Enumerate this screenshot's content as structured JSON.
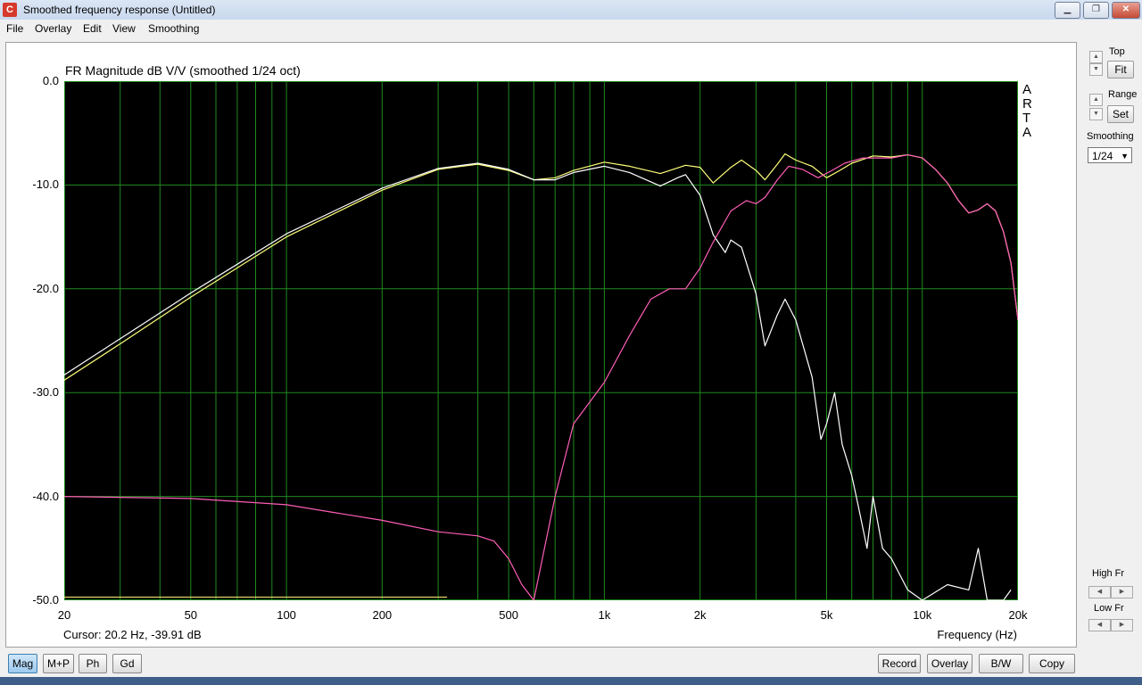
{
  "window": {
    "title": "Smoothed frequency response (Untitled)",
    "app_icon": "arta-app-icon"
  },
  "window_controls": {
    "minimize": "▁",
    "restore": "❐",
    "close": "✕"
  },
  "menu": {
    "file": "File",
    "overlay": "Overlay",
    "edit": "Edit",
    "view": "View",
    "smoothing": "Smoothing"
  },
  "plot": {
    "title": "FR Magnitude dB V/V (smoothed 1/24 oct)",
    "brand": [
      "A",
      "R",
      "T",
      "A"
    ],
    "cursor": "Cursor: 20.2 Hz, -39.91 dB",
    "xaxis_label": "Frequency (Hz)",
    "colors": {
      "background": "#000000",
      "grid": "#1f8a1f",
      "yellow": "#ffff7a",
      "white": "#ffffff",
      "pink": "#ff5db8"
    }
  },
  "chart_data": {
    "type": "line",
    "title": "FR Magnitude dB V/V (smoothed 1/24 oct)",
    "xlabel": "Frequency (Hz)",
    "ylabel": "",
    "xscale": "log",
    "xlim": [
      20,
      20000
    ],
    "ylim": [
      -50,
      0
    ],
    "xticks": [
      {
        "value": 20,
        "label": "20"
      },
      {
        "value": 50,
        "label": "50"
      },
      {
        "value": 100,
        "label": "100"
      },
      {
        "value": 200,
        "label": "200"
      },
      {
        "value": 500,
        "label": "500"
      },
      {
        "value": 1000,
        "label": "1k"
      },
      {
        "value": 2000,
        "label": "2k"
      },
      {
        "value": 5000,
        "label": "5k"
      },
      {
        "value": 10000,
        "label": "10k"
      },
      {
        "value": 20000,
        "label": "20k"
      }
    ],
    "yticks": [
      {
        "value": 0,
        "label": "0.0"
      },
      {
        "value": -10,
        "label": "-10.0"
      },
      {
        "value": -20,
        "label": "-20.0"
      },
      {
        "value": -30,
        "label": "-30.0"
      },
      {
        "value": -40,
        "label": "-40.0"
      },
      {
        "value": -50,
        "label": "-50.0"
      }
    ],
    "grid": true,
    "series": [
      {
        "color": "#ffff7a",
        "points": [
          [
            20,
            -28.8
          ],
          [
            30,
            -25.3
          ],
          [
            50,
            -20.8
          ],
          [
            100,
            -15
          ],
          [
            200,
            -10.5
          ],
          [
            300,
            -8.5
          ],
          [
            400,
            -8
          ],
          [
            500,
            -8.6
          ],
          [
            600,
            -9.5
          ],
          [
            700,
            -9.3
          ],
          [
            800,
            -8.6
          ],
          [
            1000,
            -7.8
          ],
          [
            1200,
            -8.2
          ],
          [
            1500,
            -8.9
          ],
          [
            1800,
            -8.1
          ],
          [
            2000,
            -8.3
          ],
          [
            2200,
            -9.8
          ],
          [
            2500,
            -8.3
          ],
          [
            2700,
            -7.6
          ],
          [
            3000,
            -8.6
          ],
          [
            3200,
            -9.5
          ],
          [
            3500,
            -8
          ],
          [
            3700,
            -7
          ],
          [
            4000,
            -7.6
          ],
          [
            4500,
            -8.2
          ],
          [
            5000,
            -9.3
          ],
          [
            5500,
            -8.6
          ],
          [
            6000,
            -7.9
          ],
          [
            7000,
            -7.2
          ],
          [
            8000,
            -7.3
          ],
          [
            9000,
            -7.1
          ],
          [
            10000,
            -7.4
          ],
          [
            11000,
            -8.5
          ],
          [
            12000,
            -9.8
          ],
          [
            13000,
            -11.5
          ],
          [
            14000,
            -12.7
          ],
          [
            15000,
            -12.4
          ],
          [
            16000,
            -11.8
          ],
          [
            17000,
            -12.5
          ],
          [
            18000,
            -14.5
          ],
          [
            19000,
            -17.5
          ],
          [
            20000,
            -23
          ]
        ]
      },
      {
        "color": "#ffffff",
        "points": [
          [
            20,
            -28.3
          ],
          [
            30,
            -24.8
          ],
          [
            50,
            -20.4
          ],
          [
            100,
            -14.7
          ],
          [
            200,
            -10.3
          ],
          [
            300,
            -8.4
          ],
          [
            400,
            -7.9
          ],
          [
            500,
            -8.5
          ],
          [
            600,
            -9.5
          ],
          [
            700,
            -9.5
          ],
          [
            800,
            -8.8
          ],
          [
            1000,
            -8.2
          ],
          [
            1200,
            -8.8
          ],
          [
            1500,
            -10.1
          ],
          [
            1700,
            -9.3
          ],
          [
            1800,
            -9
          ],
          [
            2000,
            -11
          ],
          [
            2200,
            -14.8
          ],
          [
            2400,
            -16.5
          ],
          [
            2500,
            -15.3
          ],
          [
            2700,
            -16
          ],
          [
            3000,
            -20.5
          ],
          [
            3200,
            -25.5
          ],
          [
            3500,
            -22.5
          ],
          [
            3700,
            -21
          ],
          [
            4000,
            -23
          ],
          [
            4500,
            -28.5
          ],
          [
            4800,
            -34.5
          ],
          [
            5000,
            -33
          ],
          [
            5300,
            -30
          ],
          [
            5600,
            -35
          ],
          [
            6000,
            -38
          ],
          [
            6300,
            -41
          ],
          [
            6700,
            -45
          ],
          [
            7000,
            -40
          ],
          [
            7500,
            -45
          ],
          [
            8000,
            -46
          ],
          [
            9000,
            -49
          ],
          [
            10000,
            -50
          ],
          [
            12000,
            -48.5
          ],
          [
            14000,
            -49
          ],
          [
            15000,
            -45
          ],
          [
            16000,
            -50
          ],
          [
            18000,
            -50
          ],
          [
            19000,
            -49
          ]
        ]
      },
      {
        "color": "#ff5db8",
        "points": [
          [
            20,
            -40
          ],
          [
            50,
            -40.2
          ],
          [
            100,
            -40.8
          ],
          [
            200,
            -42.3
          ],
          [
            300,
            -43.4
          ],
          [
            400,
            -43.8
          ],
          [
            450,
            -44.3
          ],
          [
            500,
            -46
          ],
          [
            550,
            -48.5
          ],
          [
            600,
            -50
          ],
          [
            700,
            -40
          ],
          [
            800,
            -33
          ],
          [
            1000,
            -29
          ],
          [
            1200,
            -24.5
          ],
          [
            1400,
            -21
          ],
          [
            1600,
            -20
          ],
          [
            1800,
            -20
          ],
          [
            2000,
            -18
          ],
          [
            2200,
            -15.5
          ],
          [
            2500,
            -12.5
          ],
          [
            2800,
            -11.5
          ],
          [
            3000,
            -11.8
          ],
          [
            3200,
            -11.2
          ],
          [
            3500,
            -9.5
          ],
          [
            3800,
            -8.2
          ],
          [
            4200,
            -8.5
          ],
          [
            4700,
            -9.3
          ],
          [
            5200,
            -8.6
          ],
          [
            5700,
            -7.9
          ],
          [
            6500,
            -7.4
          ],
          [
            8000,
            -7.4
          ],
          [
            9000,
            -7.1
          ],
          [
            10000,
            -7.4
          ],
          [
            11000,
            -8.5
          ],
          [
            12000,
            -9.8
          ],
          [
            13000,
            -11.5
          ],
          [
            14000,
            -12.7
          ],
          [
            15000,
            -12.4
          ],
          [
            16000,
            -11.8
          ],
          [
            17000,
            -12.5
          ],
          [
            18000,
            -14.5
          ],
          [
            19000,
            -17.5
          ],
          [
            20000,
            -23
          ]
        ]
      },
      {
        "color": "#e3d26a",
        "points": [
          [
            20,
            -49.7
          ],
          [
            320,
            -49.7
          ]
        ]
      }
    ]
  },
  "side": {
    "top_label": "Top",
    "fit": "Fit",
    "range_label": "Range",
    "set": "Set",
    "smoothing_label": "Smoothing",
    "smoothing_value": "1/24",
    "highfr_label": "High Fr",
    "lowfr_label": "Low Fr"
  },
  "bottom": {
    "mag": "Mag",
    "mp": "M+P",
    "ph": "Ph",
    "gd": "Gd",
    "record": "Record",
    "overlay": "Overlay",
    "bw": "B/W",
    "copy": "Copy"
  }
}
